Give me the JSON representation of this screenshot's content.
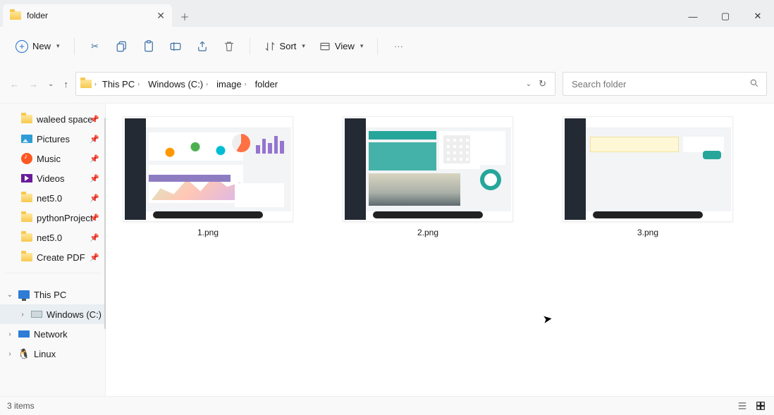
{
  "window": {
    "tab_title": "folder",
    "close_glyph": "✕",
    "plus_glyph": "＋",
    "minimize_glyph": "—",
    "maximize_glyph": "▢"
  },
  "toolbar": {
    "new_label": "New",
    "sort_label": "Sort",
    "view_label": "View",
    "more_glyph": "···"
  },
  "breadcrumb": {
    "items": [
      {
        "label": "This PC"
      },
      {
        "label": "Windows (C:)"
      },
      {
        "label": "image"
      },
      {
        "label": "folder"
      }
    ]
  },
  "nav": {
    "back_enabled": false,
    "forward_enabled": false
  },
  "search": {
    "placeholder": "Search folder"
  },
  "sidebar": {
    "items": [
      {
        "label": "waleed space",
        "type": "folder",
        "pinned": true
      },
      {
        "label": "Pictures",
        "type": "pictures",
        "pinned": true
      },
      {
        "label": "Music",
        "type": "music",
        "pinned": true
      },
      {
        "label": "Videos",
        "type": "video",
        "pinned": true
      },
      {
        "label": "net5.0",
        "type": "folder",
        "pinned": true
      },
      {
        "label": "pythonProject",
        "type": "folder",
        "pinned": true
      },
      {
        "label": "net5.0",
        "type": "folder",
        "pinned": true
      },
      {
        "label": "Create PDF",
        "type": "folder",
        "pinned": true
      }
    ],
    "tree": [
      {
        "label": "This PC",
        "type": "pc",
        "expanded": true,
        "level": 0
      },
      {
        "label": "Windows (C:)",
        "type": "drive",
        "expanded": false,
        "level": 1,
        "selected": true
      },
      {
        "label": "Network",
        "type": "net",
        "expanded": false,
        "level": 0
      },
      {
        "label": "Linux",
        "type": "linux",
        "expanded": false,
        "level": 0
      }
    ]
  },
  "files": [
    {
      "name": "1.png"
    },
    {
      "name": "2.png"
    },
    {
      "name": "3.png"
    }
  ],
  "status": {
    "text": "3 items"
  }
}
